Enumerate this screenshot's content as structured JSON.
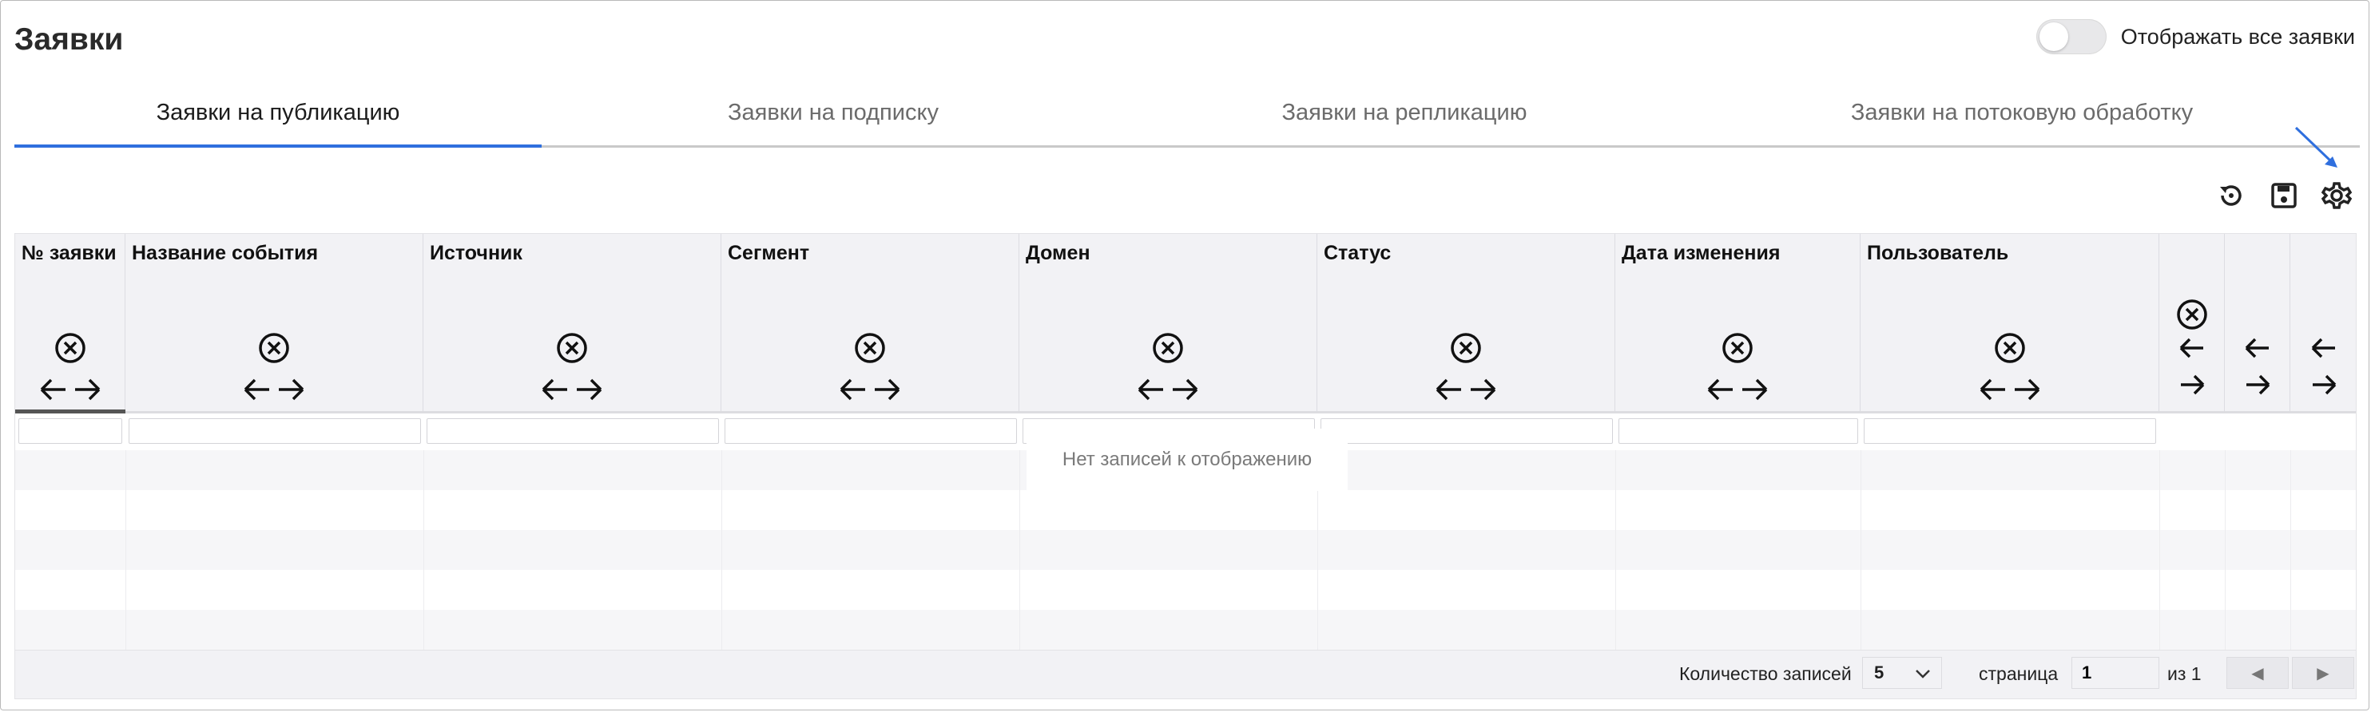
{
  "page": {
    "title": "Заявки",
    "toggle_label": "Отображать все заявки",
    "toggle_on": false
  },
  "tabs": [
    {
      "label": "Заявки на публикацию",
      "active": true
    },
    {
      "label": "Заявки на подписку",
      "active": false
    },
    {
      "label": "Заявки на репликацию",
      "active": false
    },
    {
      "label": "Заявки на потоковую обработку",
      "active": false
    }
  ],
  "toolbar": {
    "icons": [
      "reset-icon",
      "save-icon",
      "settings-icon"
    ]
  },
  "table": {
    "columns": [
      {
        "label": "№ заявки"
      },
      {
        "label": "Название события"
      },
      {
        "label": "Источник"
      },
      {
        "label": "Сегмент"
      },
      {
        "label": "Домен"
      },
      {
        "label": "Статус"
      },
      {
        "label": "Дата изменения"
      },
      {
        "label": "Пользователь"
      }
    ],
    "empty_message": "Нет записей к отображению"
  },
  "footer": {
    "records_label": "Количество записей",
    "page_size": "5",
    "page_label": "страница",
    "page_value": "1",
    "of_label": "из 1",
    "prev_symbol": "◀",
    "next_symbol": "▶"
  },
  "colors": {
    "accent": "#2f6fde",
    "header_bg": "#f2f2f5"
  }
}
